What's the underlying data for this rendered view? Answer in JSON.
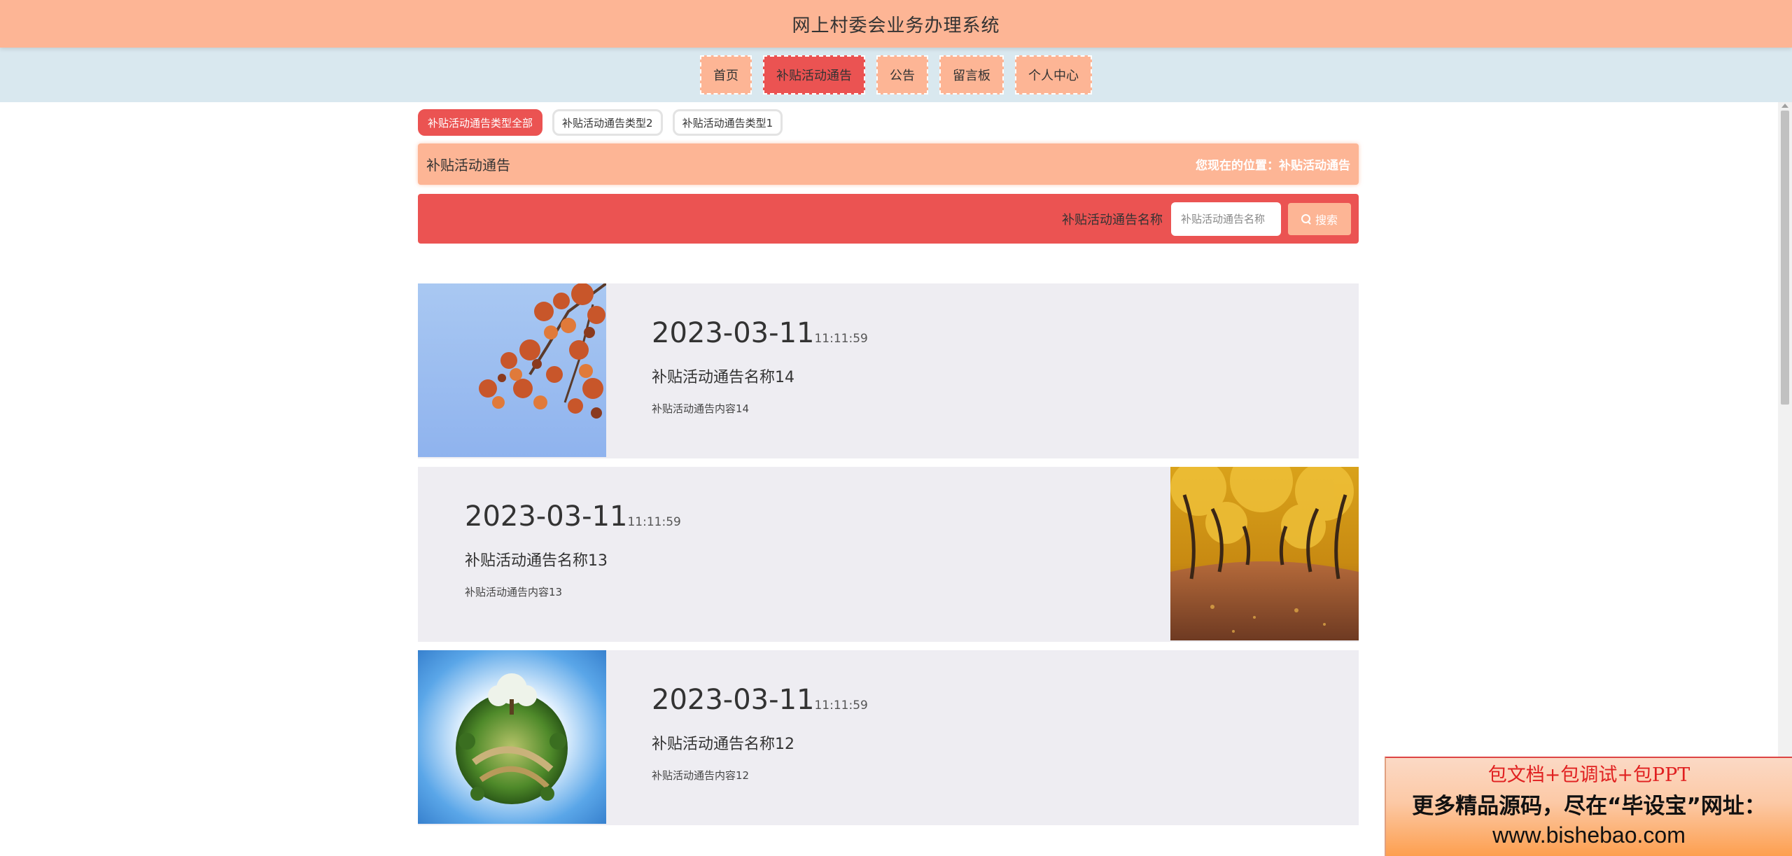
{
  "header": {
    "title": "网上村委会业务办理系统"
  },
  "nav": {
    "items": [
      {
        "label": "首页"
      },
      {
        "label": "补贴活动通告"
      },
      {
        "label": "公告"
      },
      {
        "label": "留言板"
      },
      {
        "label": "个人中心"
      }
    ],
    "active_index": 1
  },
  "type_tabs": [
    {
      "label": "补贴活动通告类型全部",
      "active": true
    },
    {
      "label": "补贴活动通告类型2",
      "active": false
    },
    {
      "label": "补贴活动通告类型1",
      "active": false
    }
  ],
  "breadcrumb": {
    "section_title": "补贴活动通告",
    "location_prefix": "您现在的位置：",
    "location_current": "补贴活动通告"
  },
  "search": {
    "label": "补贴活动通告名称",
    "placeholder": "补贴活动通告名称",
    "button_label": "搜索"
  },
  "news": [
    {
      "date": "2023-03-11",
      "time": "11:11:59",
      "title": "补贴活动通告名称14",
      "body": "补贴活动通告内容14",
      "image": "autumn-maple-leaves-photo",
      "image_side": "left"
    },
    {
      "date": "2023-03-11",
      "time": "11:11:59",
      "title": "补贴活动通告名称13",
      "body": "补贴活动通告内容13",
      "image": "golden-tree-avenue-photo",
      "image_side": "right"
    },
    {
      "date": "2023-03-11",
      "time": "11:11:59",
      "title": "补贴活动通告名称12",
      "body": "补贴活动通告内容12",
      "image": "tiny-planet-landscape-photo",
      "image_side": "left"
    }
  ],
  "promo": {
    "line1": "包文档+包调试+包PPT",
    "line2": "更多精品源码，尽在“毕设宝”网址：",
    "line3": "www.bishebao.com"
  },
  "colors": {
    "header_bg": "#fdb595",
    "nav_bg": "#d9e8ef",
    "accent_red": "#eb5352",
    "card_bg": "#eeedf2"
  }
}
